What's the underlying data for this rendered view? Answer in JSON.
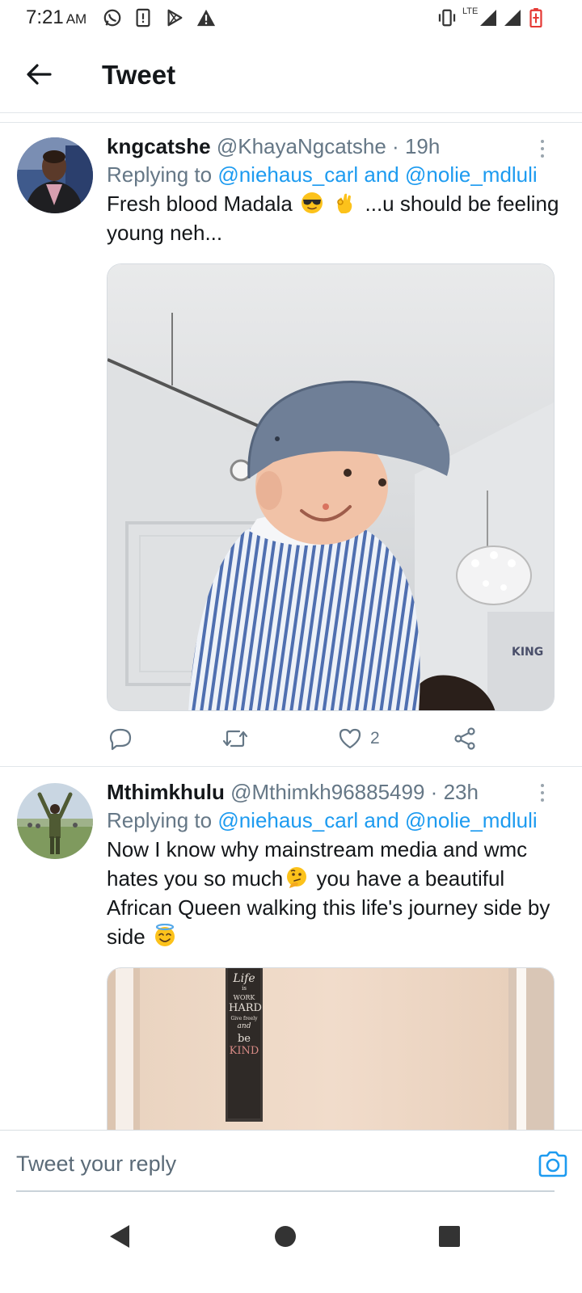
{
  "status_bar": {
    "time": "7:21",
    "ampm": "AM",
    "network_label": "LTE",
    "icons": [
      "whatsapp-icon",
      "sim-alert-icon",
      "play-store-icon",
      "warning-icon",
      "vibrate-icon",
      "signal-icon",
      "signal-icon",
      "battery-charging-icon"
    ]
  },
  "header": {
    "back_icon": "arrow-left-icon",
    "title": "Tweet"
  },
  "tweets": [
    {
      "name": "kngcatshe",
      "handle": "@KhayaNgcatshe",
      "separator": "·",
      "time": "19h",
      "replying_prefix": "Replying to",
      "mention_1": "@niehaus_carl",
      "replying_and": "and",
      "mention_2": "@nolie_mdluli",
      "text_part1": "Fresh blood Madala",
      "emoji_1": "sunglasses-emoji",
      "emoji_2": "ok-hand-emoji",
      "text_part2": "...u should be feeling young neh...",
      "media": "photo-smiling-child-in-flat-cap",
      "actions": {
        "reply_icon": "comment-icon",
        "retweet_icon": "retweet-icon",
        "like_icon": "heart-icon",
        "like_count": "2",
        "share_icon": "share-icon"
      }
    },
    {
      "name": "Mthimkhulu",
      "handle": "@Mthimkh96885499",
      "separator": "·",
      "time": "23h",
      "replying_prefix": "Replying to",
      "mention_1": "@niehaus_carl",
      "replying_and": "and",
      "mention_2": "@nolie_mdluli",
      "text_part1": "Now I know why mainstream media and wmc hates you so much",
      "emoji_1": "thinking-face-emoji",
      "text_part2": " you have a beautiful African Queen  walking this life's journey side by side",
      "emoji_2": "halo-face-emoji",
      "media": "photo-wall-sign",
      "media_sign_lines": [
        "Life",
        "is",
        "WORK",
        "HARD",
        "Give freely",
        "and",
        "be",
        "KIND"
      ]
    }
  ],
  "reply_bar": {
    "placeholder": "Tweet your reply",
    "camera_icon": "camera-icon"
  },
  "nav_bar": {
    "back": "nav-back-icon",
    "home": "nav-home-icon",
    "recents": "nav-recents-icon"
  },
  "colors": {
    "accent": "#1d9bf0",
    "text": "#14171a",
    "secondary": "#657786",
    "divider": "#e1e6ea"
  }
}
